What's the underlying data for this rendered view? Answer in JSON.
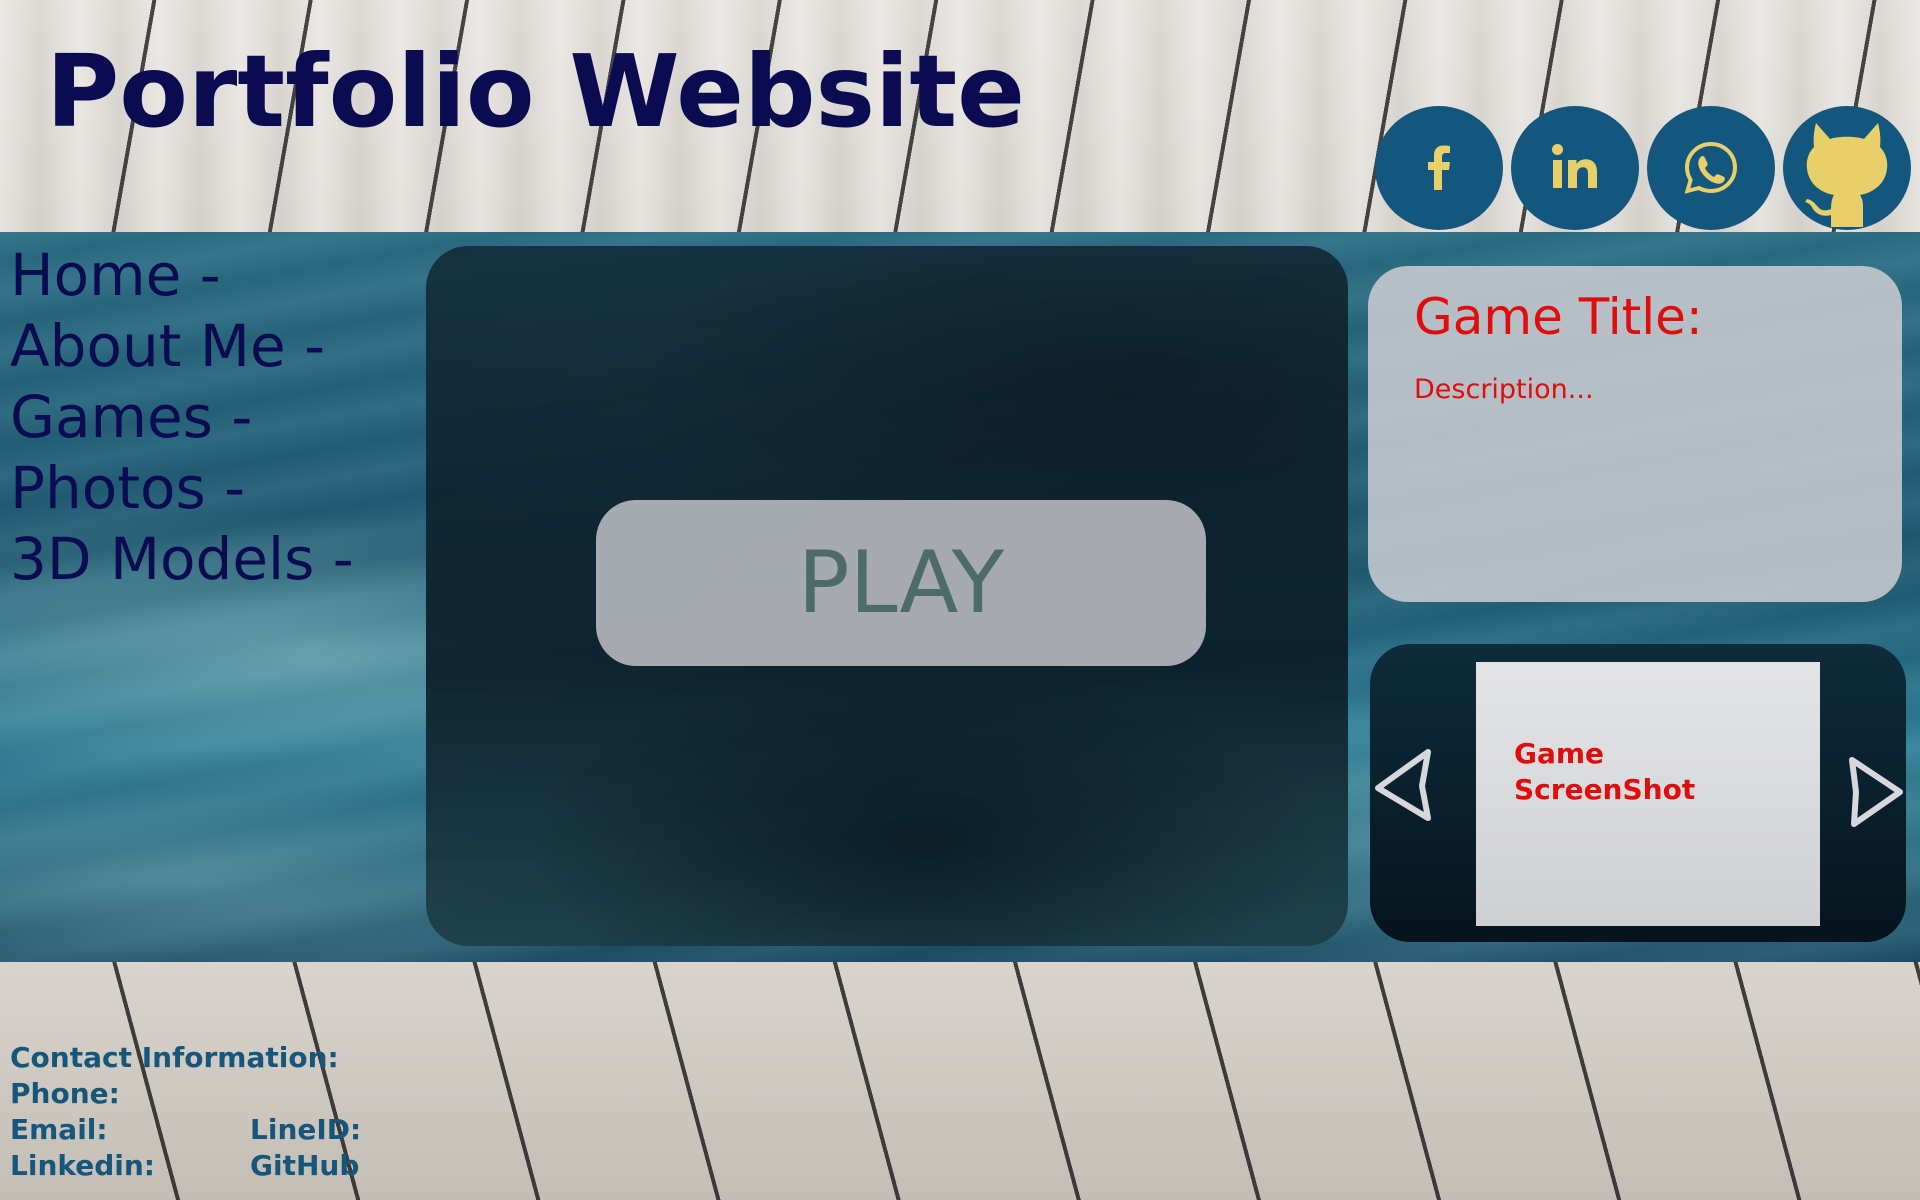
{
  "header": {
    "title": "Portfolio Website",
    "social": [
      {
        "name": "facebook",
        "icon": "facebook-icon"
      },
      {
        "name": "linkedin",
        "icon": "linkedin-icon"
      },
      {
        "name": "whatsapp",
        "icon": "whatsapp-icon"
      },
      {
        "name": "github",
        "icon": "github-icon"
      }
    ]
  },
  "nav": {
    "items": [
      {
        "label": "Home -"
      },
      {
        "label": "About Me -"
      },
      {
        "label": "Games -"
      },
      {
        "label": "Photos -"
      },
      {
        "label": "3D Models -"
      }
    ]
  },
  "main": {
    "play_label": "PLAY",
    "game_title": "Game Title:",
    "game_description": "Description...",
    "screenshot_label": "Game ScreenShot"
  },
  "contact": {
    "heading": "Contact Information:",
    "phone": "Phone:",
    "email": "Email:",
    "lineid": "LineID:",
    "linkedin": "Linkedin:",
    "github": "GitHub"
  },
  "colors": {
    "title": "#0b0b52",
    "social_bg": "#13577f",
    "social_icon": "#e8cf6a",
    "game_text": "#e00d0d",
    "contact_text": "#17567b"
  }
}
